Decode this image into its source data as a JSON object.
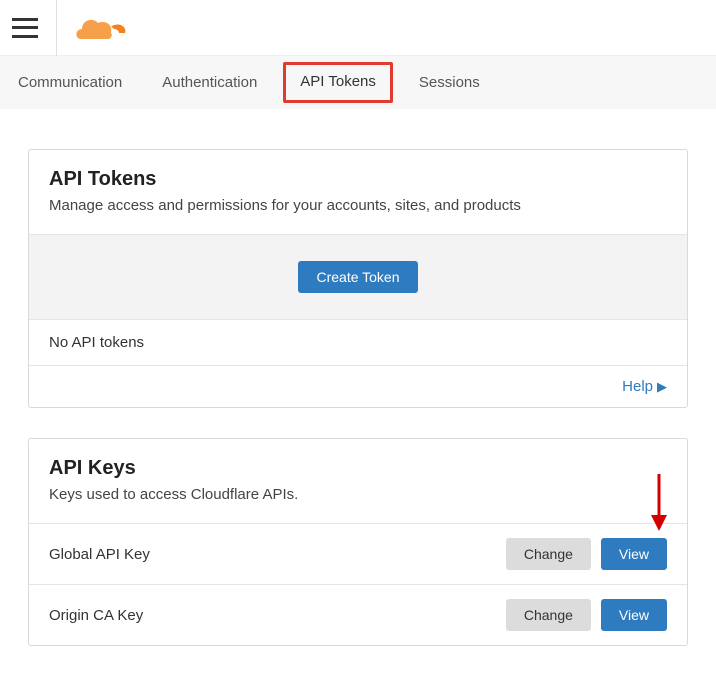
{
  "tabs": {
    "communication": "Communication",
    "authentication": "Authentication",
    "api_tokens": "API Tokens",
    "sessions": "Sessions"
  },
  "tokens_card": {
    "title": "API Tokens",
    "subtitle": "Manage access and permissions for your accounts, sites, and products",
    "create_label": "Create Token",
    "empty_msg": "No API tokens",
    "help_label": "Help"
  },
  "keys_card": {
    "title": "API Keys",
    "subtitle": "Keys used to access Cloudflare APIs.",
    "rows": [
      {
        "label": "Global API Key",
        "change": "Change",
        "view": "View"
      },
      {
        "label": "Origin CA Key",
        "change": "Change",
        "view": "View"
      }
    ]
  }
}
